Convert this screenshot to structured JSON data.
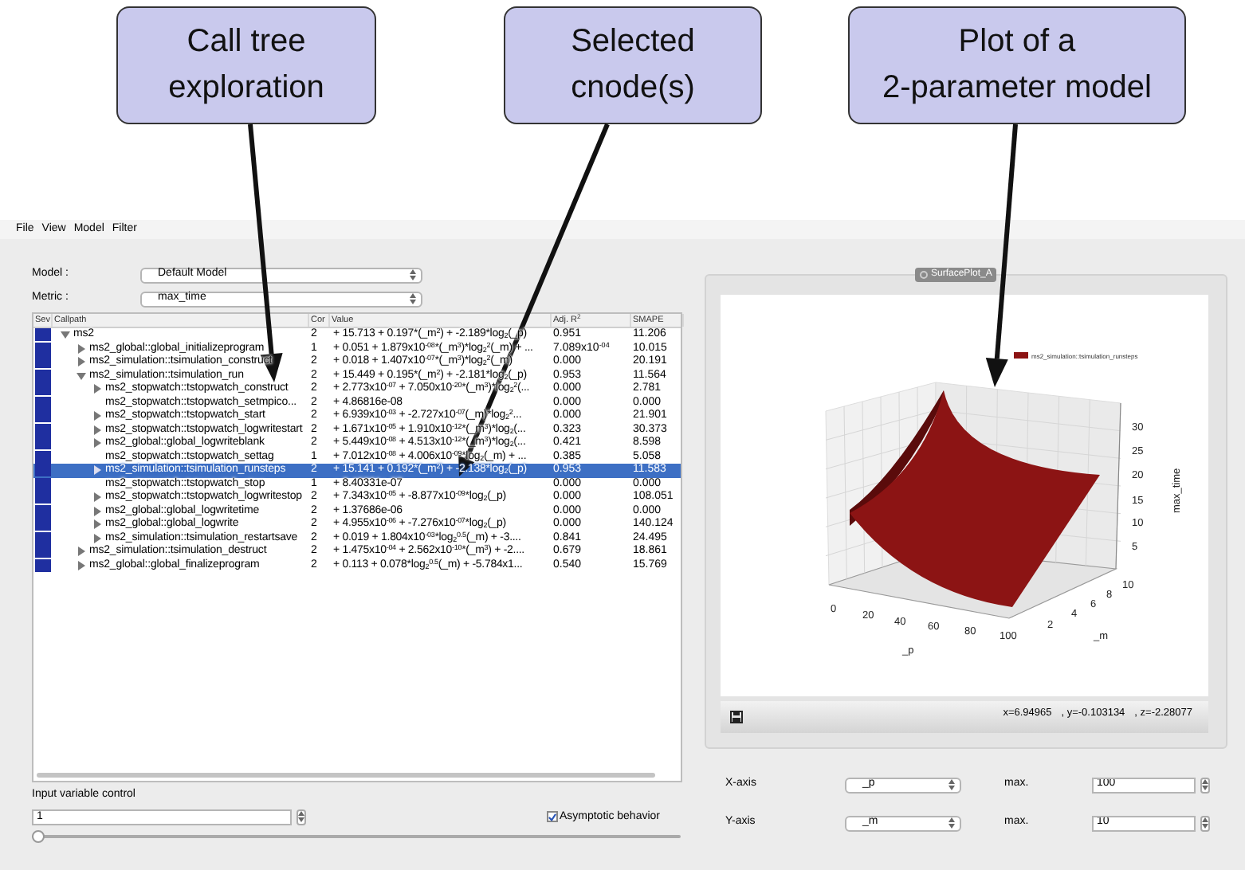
{
  "annotations": [
    {
      "text": "Call tree\nexploration"
    },
    {
      "text": "Selected\ncnode(s)"
    },
    {
      "text": "Plot of a\n2-parameter model"
    }
  ],
  "menu": [
    "File",
    "View",
    "Model",
    "Filter"
  ],
  "model_selector": {
    "label": "Model :",
    "value": "Default Model"
  },
  "metric_selector": {
    "label": "Metric :",
    "value": "max_time"
  },
  "call_tree": {
    "columns": [
      "Sev",
      "Callpath",
      "Cor",
      "Value",
      "Adj. R$^{2}$",
      "SMAPE"
    ],
    "rows": [
      {
        "kind": "node",
        "expanded": true,
        "selected": false,
        "callpath": "ms2",
        "cor": "2",
        "value": "+ 15.713 + 0.197*(_m$^{2}$) + -2.189*log$_{2}$(_p)",
        "r2": "0.951",
        "smape": "11.206",
        "children": [
          {
            "kind": "node",
            "expanded": false,
            "selected": false,
            "callpath": "ms2_global::global_initializeprogram",
            "cor": "1",
            "value": "+ 0.051 + 1.879x10$^{-08}$*(_m$^{3}$)*log$_{2}$$^{2}$(_m) + ...",
            "r2": "7.089x10$^{-04}$",
            "smape": "10.015"
          },
          {
            "kind": "node",
            "expanded": false,
            "selected": false,
            "callpath": "ms2_simulation::tsimulation_construct",
            "cor": "2",
            "value": "+ 0.018 + 1.407x10$^{-07}$*(_m$^{3}$)*log$_{2}$$^{2}$(_m)",
            "r2": "0.000",
            "smape": "20.191"
          },
          {
            "kind": "node",
            "expanded": true,
            "selected": false,
            "callpath": "ms2_simulation::tsimulation_run",
            "cor": "2",
            "value": "+ 15.449 + 0.195*(_m$^{2}$) + -2.181*log$_{2}$(_p)",
            "r2": "0.953",
            "smape": "11.564",
            "children": [
              {
                "kind": "node",
                "expanded": false,
                "selected": false,
                "callpath": "ms2_stopwatch::tstopwatch_construct",
                "cor": "2",
                "value": "+ 2.773x10$^{-07}$ + 7.050x10$^{-20}$*(_m$^{3}$)*log$_{2}$$^{2}$(...",
                "r2": "0.000",
                "smape": "2.781"
              },
              {
                "kind": "leaf",
                "selected": false,
                "callpath": "ms2_stopwatch::tstopwatch_setmpico...",
                "cor": "2",
                "value": "+ 4.86816e-08",
                "r2": "0.000",
                "smape": "0.000"
              },
              {
                "kind": "node",
                "expanded": false,
                "selected": false,
                "callpath": "ms2_stopwatch::tstopwatch_start",
                "cor": "2",
                "value": "+ 6.939x10$^{-03}$ + -2.727x10$^{-07}$(_m)*log$_{2}$$^{2}$...",
                "r2": "0.000",
                "smape": "21.901"
              },
              {
                "kind": "node",
                "expanded": false,
                "selected": false,
                "callpath": "ms2_stopwatch::tstopwatch_logwritestart",
                "cor": "2",
                "value": "+ 1.671x10$^{-05}$ + 1.910x10$^{-12}$*(_m$^{3}$)*log$_{2}$(...",
                "r2": "0.323",
                "smape": "30.373"
              },
              {
                "kind": "node",
                "expanded": false,
                "selected": false,
                "callpath": "ms2_global::global_logwriteblank",
                "cor": "2",
                "value": "+ 5.449x10$^{-08}$ + 4.513x10$^{-12}$*(_m$^{3}$)*log$_{2}$(...",
                "r2": "0.421",
                "smape": "8.598"
              },
              {
                "kind": "leaf",
                "selected": false,
                "callpath": "ms2_stopwatch::tstopwatch_settag",
                "cor": "1",
                "value": "+ 7.012x10$^{-08}$ + 4.006x10$^{-09}$*log$_{2}$(_m) + ...",
                "r2": "0.385",
                "smape": "5.058"
              },
              {
                "kind": "node",
                "expanded": false,
                "selected": true,
                "callpath": "ms2_simulation::tsimulation_runsteps",
                "cor": "2",
                "value": "+ 15.141 + 0.192*(_m$^{2}$) + -2.138*log$_{2}$(_p)",
                "r2": "0.953",
                "smape": "11.583"
              },
              {
                "kind": "leaf",
                "selected": false,
                "callpath": "ms2_stopwatch::tstopwatch_stop",
                "cor": "1",
                "value": "+ 8.40331e-07",
                "r2": "0.000",
                "smape": "0.000"
              },
              {
                "kind": "node",
                "expanded": false,
                "selected": false,
                "callpath": "ms2_stopwatch::tstopwatch_logwritestop",
                "cor": "2",
                "value": "+ 7.343x10$^{-05}$ + -8.877x10$^{-09}$*log$_{2}$(_p)",
                "r2": "0.000",
                "smape": "108.051"
              },
              {
                "kind": "node",
                "expanded": false,
                "selected": false,
                "callpath": "ms2_global::global_logwritetime",
                "cor": "2",
                "value": "+ 1.37686e-06",
                "r2": "0.000",
                "smape": "0.000"
              },
              {
                "kind": "node",
                "expanded": false,
                "selected": false,
                "callpath": "ms2_global::global_logwrite",
                "cor": "2",
                "value": "+ 4.955x10$^{-06}$ + -7.276x10$^{-07}$*log$_{2}$(_p)",
                "r2": "0.000",
                "smape": "140.124"
              },
              {
                "kind": "node",
                "expanded": false,
                "selected": false,
                "callpath": "ms2_simulation::tsimulation_restartsave",
                "cor": "2",
                "value": "+ 0.019 + 1.804x10$^{-03}$*log$_{2}$$^{0.5}$(_m) + -3....",
                "r2": "0.841",
                "smape": "24.495"
              }
            ]
          },
          {
            "kind": "node",
            "expanded": false,
            "selected": false,
            "callpath": "ms2_simulation::tsimulation_destruct",
            "cor": "2",
            "value": "+ 1.475x10$^{-04}$ + 2.562x10$^{-10}$*(_m$^{3}$) + -2....",
            "r2": "0.679",
            "smape": "18.861"
          },
          {
            "kind": "node",
            "expanded": false,
            "selected": false,
            "callpath": "ms2_global::global_finalizeprogram",
            "cor": "2",
            "value": "+ 0.113 + 0.078*log$_{2}$$^{0.5}$(_m) + -5.784x1...",
            "r2": "0.540",
            "smape": "15.769"
          }
        ]
      }
    ]
  },
  "input_variable_control": {
    "title": "Input variable control",
    "value": "1",
    "asymptotic": {
      "label": "Asymptotic behavior",
      "checked": true
    },
    "slider": {
      "level": 0
    }
  },
  "plot_window": {
    "title": "SurfacePlot_A",
    "legend": "ms2_simulation::tsimulation_runsteps",
    "x_label": "_p",
    "y_label": "_m",
    "z_label": "max_time",
    "x_ticks": [
      "0",
      "20",
      "40",
      "60",
      "80",
      "100"
    ],
    "y_ticks": [
      "2",
      "4",
      "6",
      "8",
      "10"
    ],
    "z_ticks": [
      "30",
      "25",
      "20",
      "15",
      "10",
      "5"
    ],
    "status": [
      "x=6.94965",
      ", y=-0.103134",
      ", z=-2.28077"
    ]
  },
  "axis_controls": [
    {
      "label": "X-axis",
      "variable": "_p",
      "max_label": "max.",
      "max": "100"
    },
    {
      "label": "Y-axis",
      "variable": "_m",
      "max_label": "max.",
      "max": "10"
    }
  ]
}
